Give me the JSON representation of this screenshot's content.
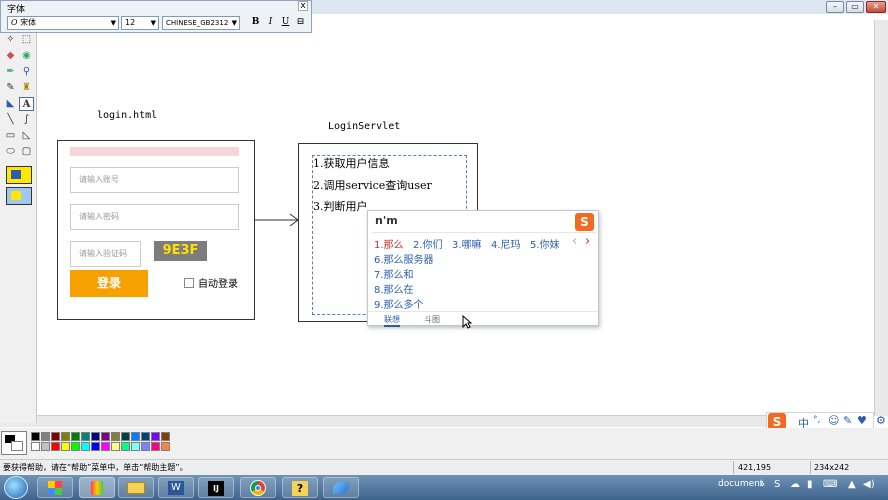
{
  "font_toolbar": {
    "title": "字体",
    "close": "x",
    "font_name": "宋体",
    "font_size": "12",
    "charset": "CHINESE_GB2312",
    "bold": "B",
    "italic": "I",
    "underline": "U",
    "vertical": "⊟"
  },
  "canvas": {
    "login_label": "login.html",
    "servlet_label": "LoginServlet",
    "login_form": {
      "account_placeholder": "请输入账号",
      "password_placeholder": "请输入密码",
      "captcha_placeholder": "请输入验证码",
      "captcha_code": "9E3F",
      "login_button": "登录",
      "auto_login": "自动登录"
    },
    "steps": [
      "1.获取用户信息",
      "2.调用service查询user",
      "3.判断用户"
    ]
  },
  "ime": {
    "input": "n'm",
    "candidates_row": [
      "1.那么",
      "2.你们",
      "3.哪嘛",
      "4.尼玛",
      "5.你妹"
    ],
    "candidates_list": [
      "6.那么服务器",
      "7.那么和",
      "8.那么在",
      "9.那么多个"
    ],
    "tabs": [
      "联想",
      "斗图"
    ],
    "prev": "‹",
    "next": "›",
    "logo": "S"
  },
  "ime_toolbar": {
    "logo": "S",
    "items": [
      "中",
      "°,",
      "☺",
      "✎",
      "♥",
      "⚙"
    ]
  },
  "status": {
    "help_text": "要获得帮助，请在“帮助”菜单中，单击“帮助主题”。",
    "cursor_pos": "421,195",
    "selection_size": "234x242"
  },
  "taskbar": {
    "apps": [
      "explorer",
      "paint",
      "folder",
      "word",
      "intellij",
      "chrome",
      "help",
      "feather"
    ],
    "ij_label": "IJ",
    "document_label": "document",
    "help_glyph": "?"
  },
  "colors": {
    "accent_orange": "#f7a100",
    "captcha_bg": "#7d7d7d",
    "pink_bar": "#f4d6db",
    "ime_red": "#c0302a",
    "ime_blue": "#2a5db0"
  }
}
